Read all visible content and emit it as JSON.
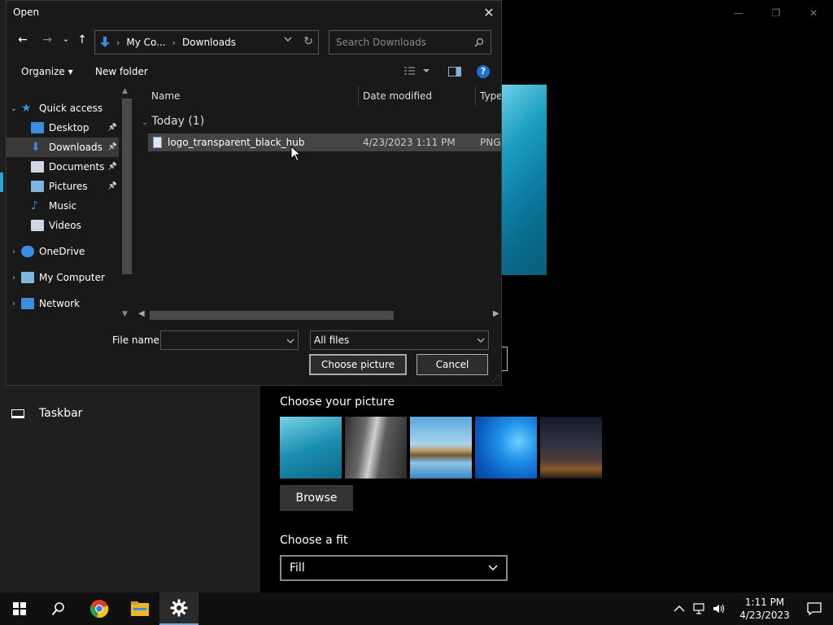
{
  "background": {
    "sidebar_taskbar_label": "Taskbar",
    "choose_picture_title": "Choose your picture",
    "browse_label": "Browse",
    "choose_fit_title": "Choose a fit",
    "fit_value": "Fill",
    "window_controls": {
      "minimize": "—",
      "restore": "❐",
      "close": "✕"
    }
  },
  "dialog": {
    "title": "Open",
    "close": "✕",
    "nav": {
      "back": "←",
      "forward": "→",
      "recent": "⌄",
      "up": "↑"
    },
    "breadcrumb": [
      "My Co...",
      "Downloads"
    ],
    "breadcrumb_sep": "›",
    "search_placeholder": "Search Downloads",
    "toolbar": {
      "organize": "Organize ▾",
      "new_folder": "New folder",
      "help": "?"
    },
    "nav_pane": [
      {
        "label": "Quick access",
        "chev": "⌄",
        "icon": "star-icon",
        "pinned": false
      },
      {
        "label": "Desktop",
        "icon": "desktop-icon",
        "pinned": true
      },
      {
        "label": "Downloads",
        "icon": "download-icon",
        "pinned": true,
        "selected": true
      },
      {
        "label": "Documents",
        "icon": "document-icon",
        "pinned": true
      },
      {
        "label": "Pictures",
        "icon": "picture-icon",
        "pinned": true
      },
      {
        "label": "Music",
        "icon": "music-icon",
        "pinned": false
      },
      {
        "label": "Videos",
        "icon": "video-icon",
        "pinned": false
      },
      {
        "label": "OneDrive",
        "chev": "›",
        "icon": "cloud-icon",
        "pinned": false
      },
      {
        "label": "My Computer",
        "chev": "›",
        "icon": "computer-icon",
        "pinned": false
      },
      {
        "label": "Network",
        "chev": "›",
        "icon": "network-icon",
        "pinned": false
      }
    ],
    "columns": {
      "name": "Name",
      "date": "Date modified",
      "type": "Type"
    },
    "group": "Today (1)",
    "files": [
      {
        "name": "logo_transparent_black_hub",
        "date": "4/23/2023 1:11 PM",
        "type": "PNG"
      }
    ],
    "file_name_label": "File name:",
    "file_name_value": "",
    "file_type": "All files",
    "choose_button": "Choose picture",
    "cancel_button": "Cancel"
  },
  "taskbar": {
    "time": "1:11 PM",
    "date": "4/23/2023"
  }
}
